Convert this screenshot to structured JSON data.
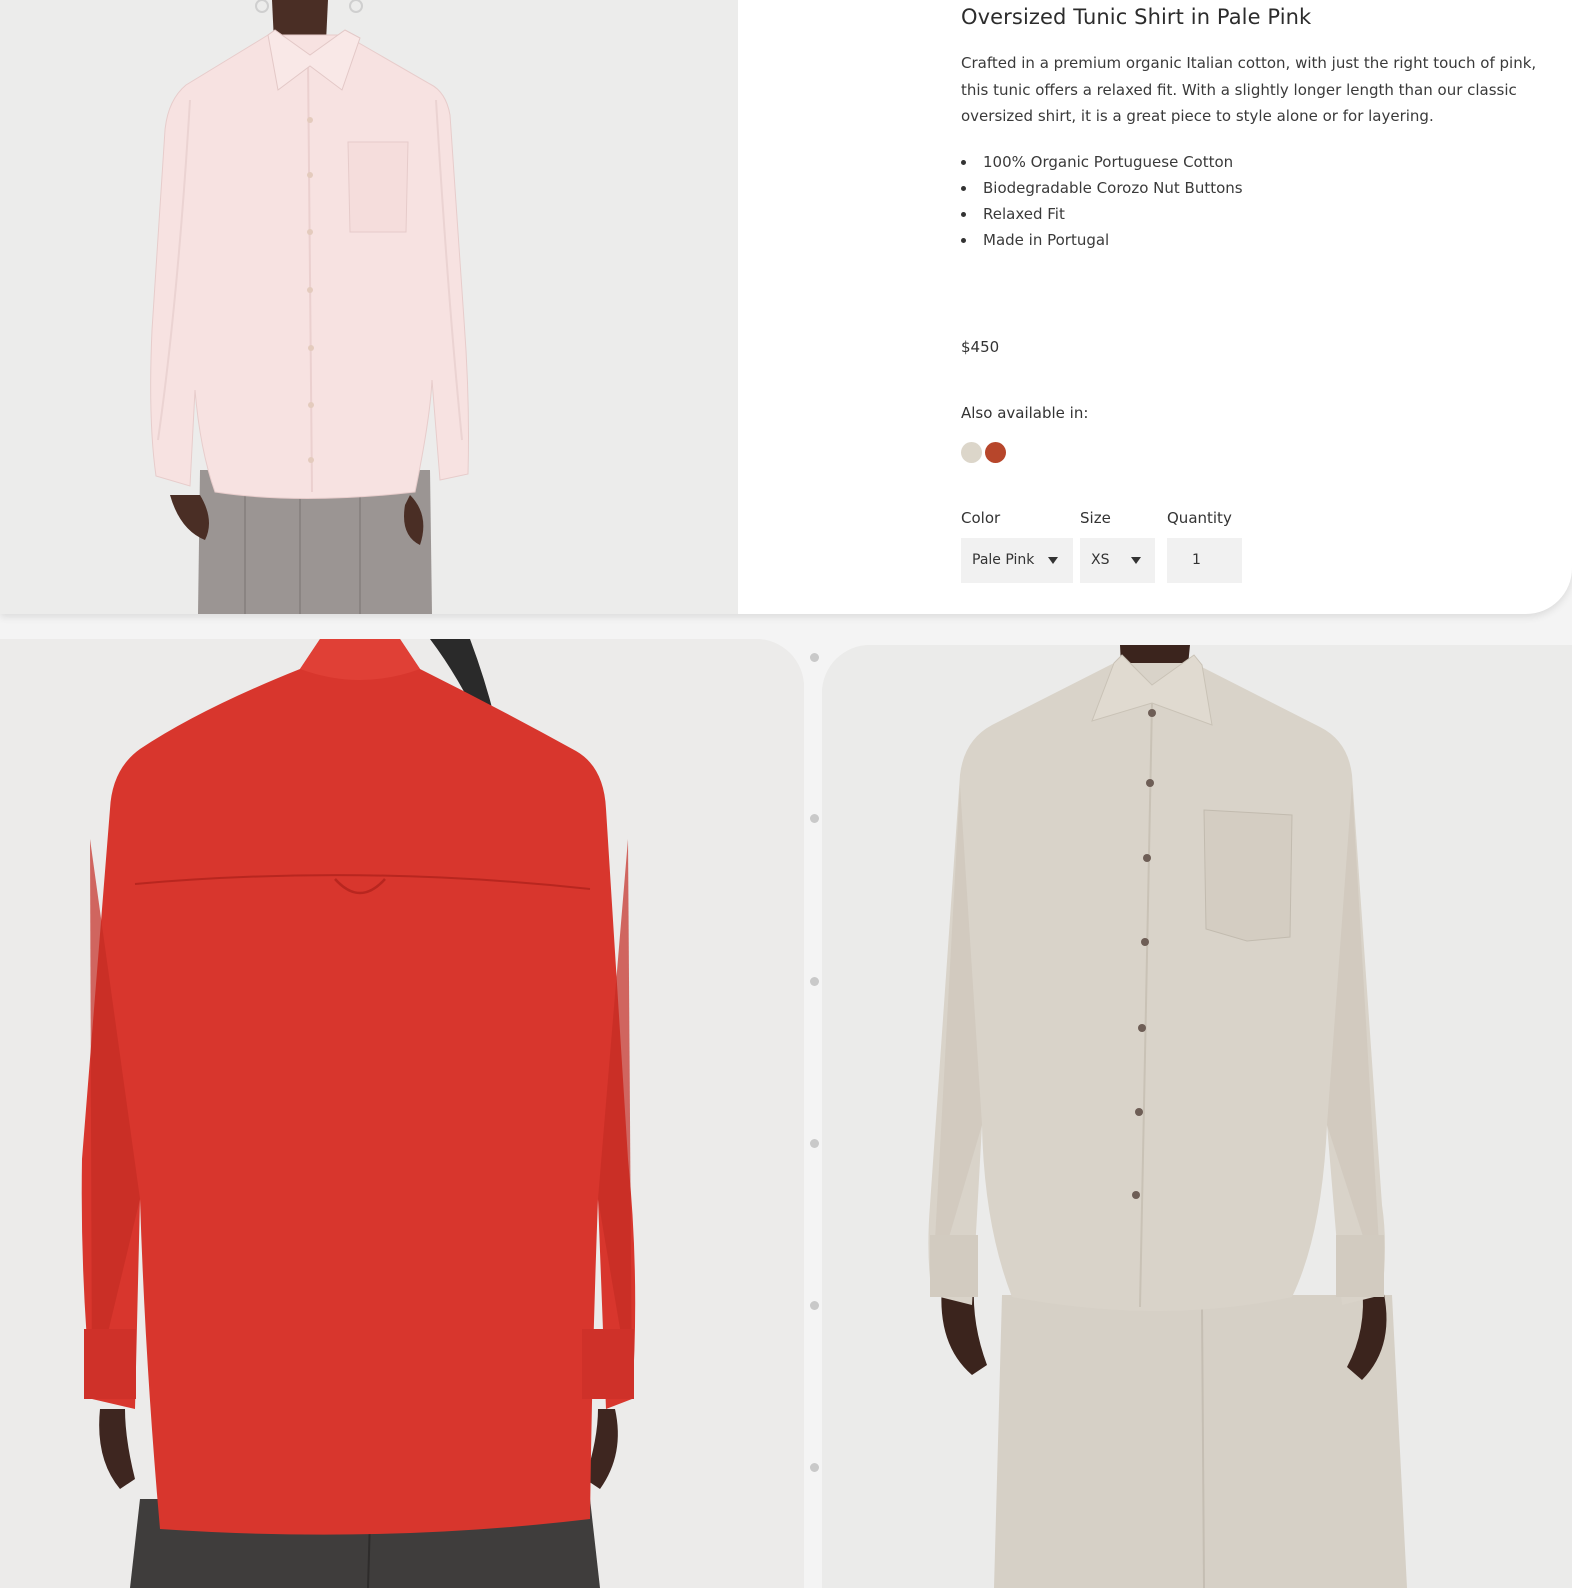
{
  "product": {
    "title": "Oversized Tunic Shirt in Pale Pink",
    "description": "Crafted in a premium organic Italian cotton, with just the right touch of pink, this tunic offers a relaxed fit. With a slightly longer length than our classic oversized shirt, it is a great piece to style alone or for layering.",
    "features": [
      "100% Organic Portuguese Cotton",
      "Biodegradable Corozo Nut Buttons",
      "Relaxed Fit",
      "Made in Portugal"
    ],
    "price": "$450",
    "also_available_label": "Also available in:",
    "swatches": [
      {
        "icon": "color-swatch-oatmeal",
        "color": "#dcd6ca"
      },
      {
        "icon": "color-swatch-red",
        "color": "#b7462b"
      }
    ]
  },
  "options": {
    "color_label": "Color",
    "color_value": "Pale Pink",
    "size_label": "Size",
    "size_value": "XS",
    "quantity_label": "Quantity",
    "quantity_value": "1"
  },
  "colors": {
    "pale_pink": "#f7e1e0",
    "red": "#d8362d",
    "oatmeal": "#d9d3c9"
  }
}
